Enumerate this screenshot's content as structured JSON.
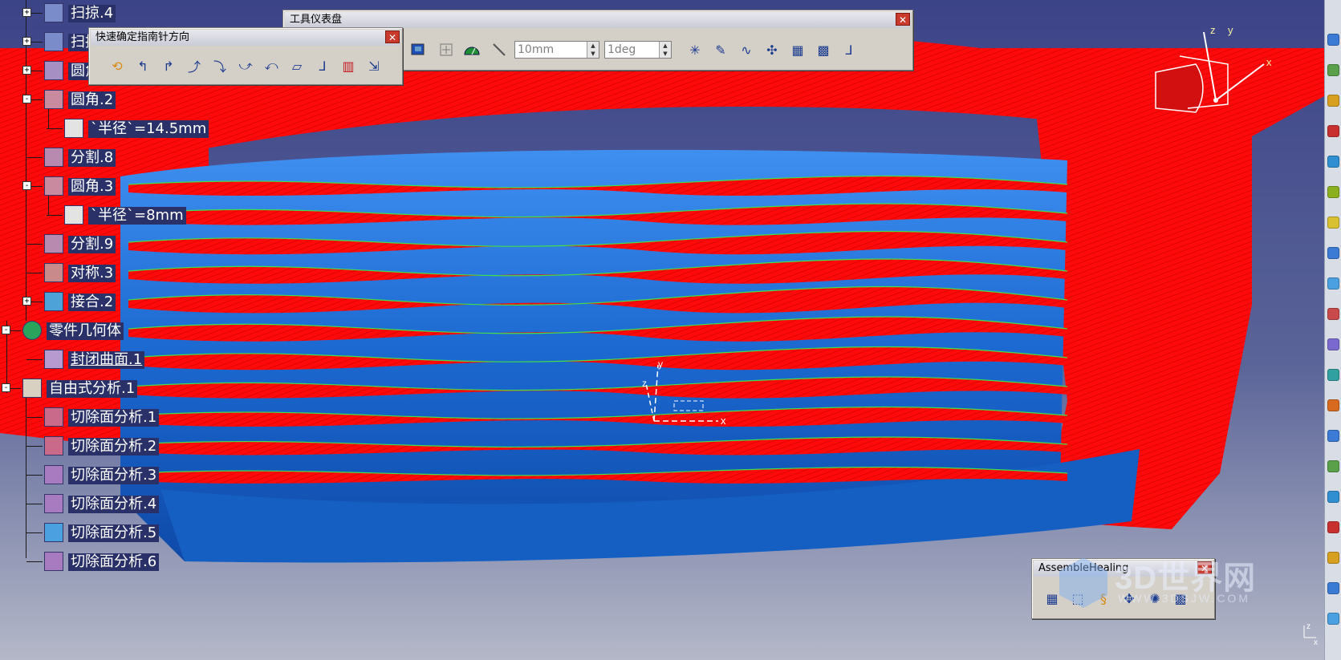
{
  "tree": {
    "items": [
      {
        "label": "扫掠.4"
      },
      {
        "label": "扫掠"
      },
      {
        "label": "圆角"
      },
      {
        "label": "圆角.2"
      },
      {
        "label": "`半径`=14.5mm"
      },
      {
        "label": "分割.8"
      },
      {
        "label": "圆角.3"
      },
      {
        "label": "`半径`=8mm"
      },
      {
        "label": "分割.9"
      },
      {
        "label": "对称.3"
      },
      {
        "label": "接合.2"
      },
      {
        "label": "零件几何体"
      },
      {
        "label": "封闭曲面.1"
      },
      {
        "label": "自由式分析.1"
      },
      {
        "label": "切除面分析.1"
      },
      {
        "label": "切除面分析.2"
      },
      {
        "label": "切除面分析.3"
      },
      {
        "label": "切除面分析.4"
      },
      {
        "label": "切除面分析.5"
      },
      {
        "label": "切除面分析.6"
      }
    ]
  },
  "dashboard": {
    "title": "工具仪表盘",
    "close": "✕",
    "length_value": "10mm",
    "angle_value": "1deg"
  },
  "compass_toolbar": {
    "title": "快速确定指南针方向",
    "close": "✕"
  },
  "assemble_toolbar": {
    "title": "AssembleHealing",
    "close": "✕"
  },
  "axes": {
    "x": "x",
    "y": "y",
    "z": "z"
  },
  "watermark": {
    "brand": "3D世界网",
    "url": "WWW.3DSJW.COM"
  },
  "colors": {
    "surface_blue": "#1b68d0",
    "analysis_red": "#ff0a0a",
    "curve_green": "#3fe04a",
    "background_top": "#3c4488",
    "background_bottom": "#b4b8c8",
    "tree_label_bg": "#2a3168"
  }
}
